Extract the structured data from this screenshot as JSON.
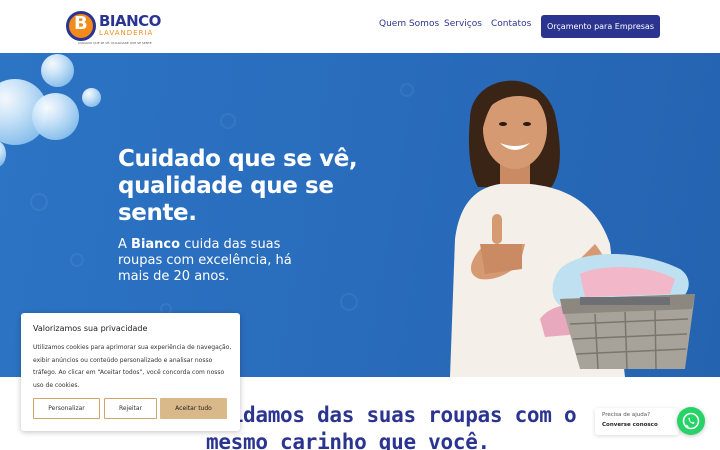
{
  "header": {
    "logo": {
      "letter": "B",
      "name": "BIANCO",
      "subtitle": "LAVANDERIA",
      "tagline": "CUIDADO QUE SE VÊ, QUALIDADE QUE SE SENTE"
    },
    "nav": [
      {
        "label": "Quem Somos"
      },
      {
        "label": "Serviços"
      },
      {
        "label": "Contatos"
      }
    ],
    "cta_label": "Orçamento para Empresas"
  },
  "hero": {
    "title": "Cuidado que se vê, qualidade que se sente.",
    "text_prefix": "A ",
    "text_brand": "Bianco",
    "text_suffix": " cuida das suas roupas com excelência, há mais de 20 anos."
  },
  "section": {
    "title": "Cuidamos das suas roupas com o mesmo carinho que você."
  },
  "cookie_banner": {
    "title": "Valorizamos sua privacidade",
    "text": "Utilizamos cookies para aprimorar sua experiência de navegação, exibir anúncios ou conteúdo personalizado e analisar nosso tráfego. Ao clicar em “Aceitar todos”, você concorda com nosso uso de cookies.",
    "buttons": {
      "customize": "Personalizar",
      "reject": "Rejeitar",
      "accept": "Aceitar tudo"
    }
  },
  "chat": {
    "line1": "Precisa de ajuda?",
    "line2": "Converse conosco",
    "icon": "whatsapp-icon"
  },
  "colors": {
    "brand_blue": "#2b3590",
    "brand_orange": "#f28a1c",
    "hero_blue": "#2a6dbd",
    "accept_button": "#d9b98a",
    "whatsapp_green": "#25d366"
  }
}
